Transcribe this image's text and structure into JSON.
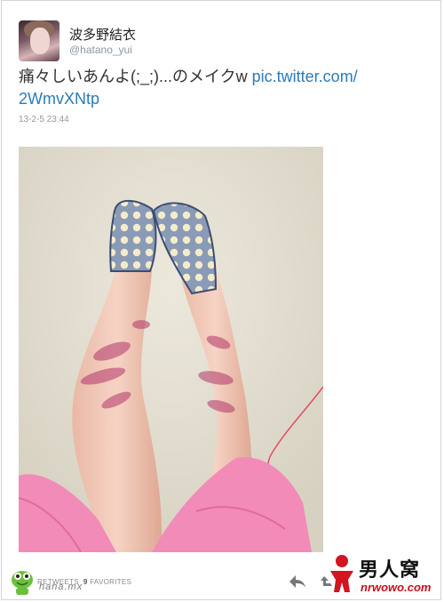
{
  "user": {
    "display_name": "波多野結衣",
    "handle": "@hatano_yui"
  },
  "tweet": {
    "text": "痛々しいあんよ(;_;)...のメイクw ",
    "link_part1": "pic.twitter.com/",
    "link_part2": "2WmvXNtp",
    "timestamp": "13-2-5 23:44"
  },
  "footer": {
    "retweets_label": "RETWEETS",
    "favorites_count": "9",
    "favorites_label": "FAVORITES",
    "reply_icon": "reply-icon",
    "retweet_icon": "retweet-icon"
  },
  "watermarks": {
    "left_text": "hana.mx",
    "brand_title": "男人窝",
    "brand_url": "nrwowo.com"
  },
  "colors": {
    "link": "#2b7bb9",
    "brand_red": "#c8101c"
  }
}
